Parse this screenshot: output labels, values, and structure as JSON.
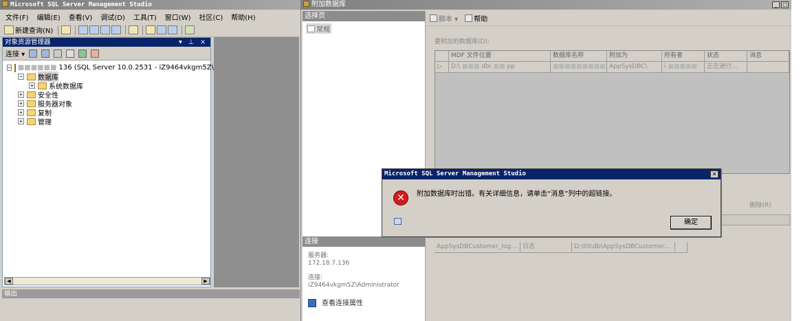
{
  "main_window": {
    "title": "Microsoft SQL Server Management Studio",
    "menu": [
      "文件(F)",
      "编辑(E)",
      "查看(V)",
      "调试(D)",
      "工具(T)",
      "窗口(W)",
      "社区(C)",
      "帮助(H)"
    ],
    "toolbar": {
      "new_query": "新建查询(N)"
    }
  },
  "object_explorer": {
    "title": "对象资源管理器",
    "pin_icons": "▾ ⊥ ×",
    "connect_label": "连接 ▾",
    "server_node_visible": "136 (SQL Server 10.0.2531 - iZ9464vkgm5Z\\Admini",
    "nodes": {
      "databases": "数据库",
      "system_databases": "系统数据库",
      "security": "安全性",
      "server_objects": "服务器对象",
      "replication": "复制",
      "management": "管理"
    }
  },
  "output_panel": {
    "title": "输出"
  },
  "attach_dialog": {
    "title": "附加数据库",
    "select_page_header": "选择页",
    "page_general": "常规",
    "toolbar": {
      "script": "脚本 ▾",
      "help": "帮助"
    },
    "section_label": "要附加的数据库(D):",
    "columns": [
      "MDF 文件位置",
      "数据库名称",
      "附加为",
      "所有者",
      "状态",
      "消息"
    ],
    "row": {
      "mdf": "D:\\",
      "mdf_tail": "db\\",
      "mdf_end": "pp",
      "dbname": "s",
      "attach_as": "AppSysDBC\\",
      "owner": "i",
      "status": "正在进行..."
    },
    "remove_button": "删除(R)",
    "details_rows": [
      {
        "name": "AppSysDBCustomer_log...",
        "type": "日志",
        "path": "D:\\IIS\\db\\AppSysDBCustomer..."
      }
    ],
    "connection_header": "连接",
    "server_label": "服务器:",
    "server_value": "172.18.7.136",
    "connection_label": "连接:",
    "connection_value": "iZ9464vkgm5Z\\Administrator",
    "view_connection": "查看连接属性"
  },
  "message_box": {
    "title": "Microsoft SQL Server Management Studio",
    "message": "附加数据库时出错。有关详细信息，请单击“消息”列中的超链接。",
    "ok_label": "确定",
    "error_glyph": "✕",
    "close_glyph": "✕"
  }
}
